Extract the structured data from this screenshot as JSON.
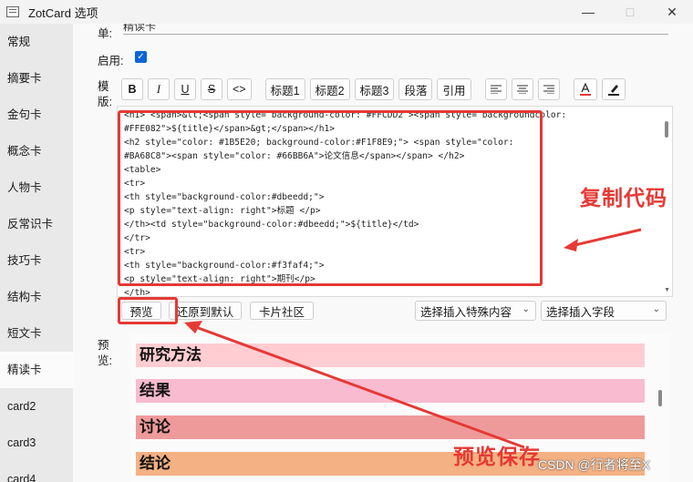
{
  "window": {
    "title": "ZotCard 选项",
    "controls": [
      "—",
      "□",
      "✕"
    ]
  },
  "sidebar": {
    "items": [
      {
        "label": "常规"
      },
      {
        "label": "摘要卡"
      },
      {
        "label": "金句卡"
      },
      {
        "label": "概念卡"
      },
      {
        "label": "人物卡"
      },
      {
        "label": "反常识卡"
      },
      {
        "label": "技巧卡"
      },
      {
        "label": "结构卡"
      },
      {
        "label": "短文卡"
      },
      {
        "label": "精读卡"
      },
      {
        "label": "card2"
      },
      {
        "label": "card3"
      },
      {
        "label": "card4"
      }
    ],
    "active_index": 9
  },
  "form": {
    "name_label": "单:",
    "name_value": "精读卡",
    "enabled_label": "启用:",
    "enabled_checked": true,
    "template_label_1": "模",
    "template_label_2": "版:",
    "preview_label_1": "预",
    "preview_label_2": "览:"
  },
  "toolbar": {
    "bold": "B",
    "italic": "I",
    "underline": "U",
    "strike": "S",
    "code": "<>",
    "h1": "标题1",
    "h2": "标题2",
    "h3": "标题3",
    "paragraph": "段落",
    "quote": "引用",
    "align_left_icon": "align-left-icon",
    "align_center_icon": "align-center-icon",
    "align_right_icon": "align-right-icon",
    "font_color_icon": "font-color-icon",
    "highlight_icon": "highlighter-icon"
  },
  "editor": {
    "lines": [
      "<h1> <span>&lt;<span style= background-color: #FFCDD2 ><span style= backgroundcolor:",
      "#FFE082\">${title}</span>&gt;</span></h1>",
      "<h2 style=\"color: #1B5E20; background-color:#F1F8E9;\"> <span style=\"color:",
      "#BA68C8\"><span style=\"color: #66BB6A\">论文信息</span></span> </h2>",
      "<table>",
      "<tr>",
      "<th style=\"background-color:#dbeedd;\">",
      "<p style=\"text-align: right\">标题 </p>",
      "</th><td style=\"background-color:#dbeedd;\">${title}</td>",
      "</tr>",
      "<tr>",
      "<th style=\"background-color:#f3faf4;\">",
      "<p style=\"text-align: right\">期刊</p>",
      "</th>"
    ]
  },
  "actions": {
    "preview": "预览",
    "restore_default": "还原到默认",
    "card_community": "卡片社区",
    "insert_special": "选择插入特殊内容",
    "insert_field": "选择插入字段"
  },
  "preview": {
    "sections": [
      {
        "label": "研究方法",
        "color": "#ffcdd2"
      },
      {
        "label": "结果",
        "color": "#f8bbd0"
      },
      {
        "label": "讨论",
        "color": "#ef9a9a"
      },
      {
        "label": "结论",
        "color": "#f4b183"
      }
    ]
  },
  "annotations": {
    "copy_code": "复制代码",
    "preview_save": "预览保存",
    "accent_color": "#e53935"
  },
  "watermark": "CSDN @行者将至X"
}
